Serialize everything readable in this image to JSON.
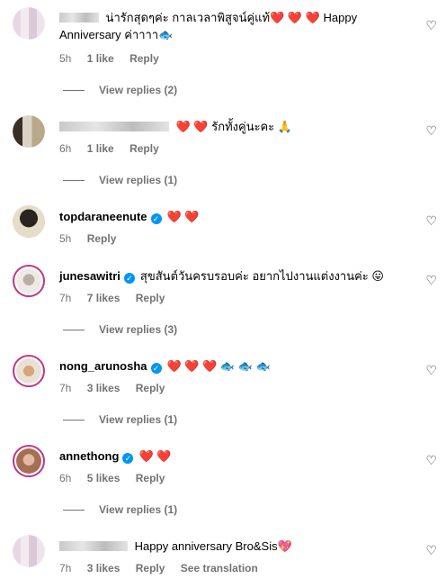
{
  "comments": [
    {
      "user": "",
      "text": "น่ารักสุดๆค่ะ กาลเวลาพิสูจน์คู่แท้❤️ ❤️ ❤️ Happy Anniversary ค่าาาา🐟",
      "time": "5h",
      "likes": "1 like",
      "reply": "Reply",
      "view_replies": "View replies (2)"
    },
    {
      "user": "",
      "text": "❤️ ❤️ รักทั้งคู่นะคะ 🙏",
      "time": "6h",
      "likes": "1 like",
      "reply": "Reply",
      "view_replies": "View replies (1)"
    },
    {
      "user": "topdaraneenute",
      "text": "❤️ ❤️",
      "time": "5h",
      "reply": "Reply"
    },
    {
      "user": "junesawitri",
      "text": "สุขสันต์วันครบรอบค่ะ อยากไปงานแต่งงานค่ะ 😛",
      "time": "7h",
      "likes": "7 likes",
      "reply": "Reply",
      "view_replies": "View replies (3)"
    },
    {
      "user": "nong_arunosha",
      "text": "❤️ ❤️ ❤️ 🐟 🐟 🐟",
      "time": "7h",
      "likes": "3 likes",
      "reply": "Reply",
      "view_replies": "View replies (1)"
    },
    {
      "user": "annethong",
      "text": "❤️ ❤️",
      "time": "6h",
      "likes": "5 likes",
      "reply": "Reply",
      "view_replies": "View replies (1)"
    },
    {
      "user": "",
      "text": "Happy anniversary Bro&Sis💖",
      "time": "7h",
      "likes": "3 likes",
      "reply": "Reply",
      "see_translation": "See translation"
    }
  ],
  "icons": {
    "like": "heart-outline-icon",
    "verified": "verified-badge-icon"
  }
}
